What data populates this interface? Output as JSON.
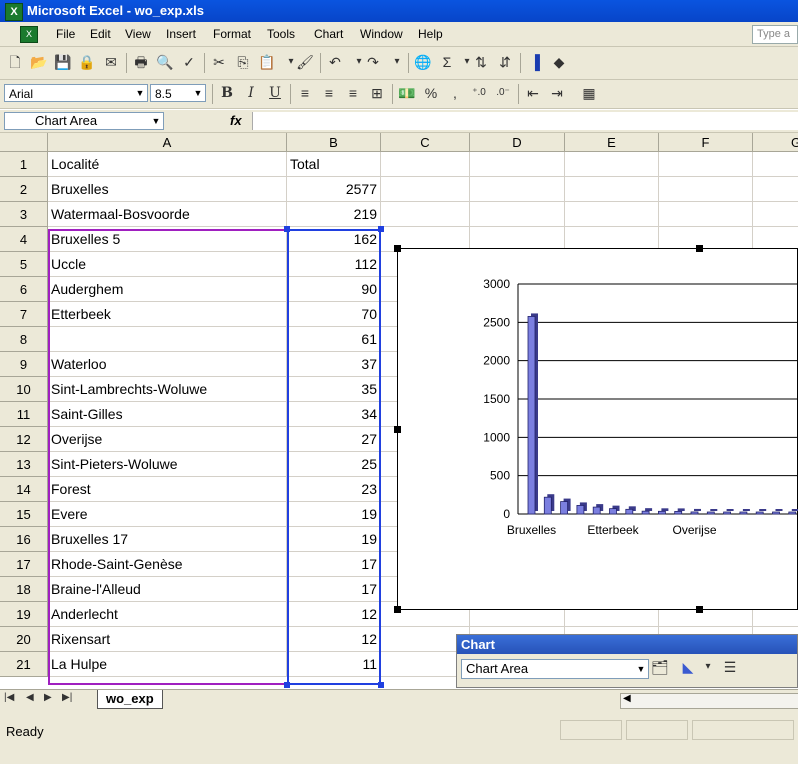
{
  "window": {
    "title": "Microsoft Excel - wo_exp.xls"
  },
  "menu": {
    "items": [
      "File",
      "Edit",
      "View",
      "Insert",
      "Format",
      "Tools",
      "Chart",
      "Window",
      "Help"
    ],
    "type_question": "Type a"
  },
  "format_toolbar": {
    "font": "Arial",
    "size": "8.5",
    "percent": "%",
    "comma": ","
  },
  "formula_bar": {
    "name_box": "Chart Area",
    "fx": "fx"
  },
  "columns": [
    "A",
    "B",
    "C",
    "D",
    "E",
    "F",
    "G"
  ],
  "rows": [
    {
      "n": "1",
      "a": "Localité",
      "b": "Total"
    },
    {
      "n": "2",
      "a": "Bruxelles",
      "b": "2577"
    },
    {
      "n": "3",
      "a": "Watermaal-Bosvoorde",
      "b": "219"
    },
    {
      "n": "4",
      "a": "Bruxelles 5",
      "b": "162"
    },
    {
      "n": "5",
      "a": "Uccle",
      "b": "112"
    },
    {
      "n": "6",
      "a": "Auderghem",
      "b": "90"
    },
    {
      "n": "7",
      "a": "Etterbeek",
      "b": "70"
    },
    {
      "n": "8",
      "a": "",
      "b": "61"
    },
    {
      "n": "9",
      "a": "Waterloo",
      "b": "37"
    },
    {
      "n": "10",
      "a": "Sint-Lambrechts-Woluwe",
      "b": "35"
    },
    {
      "n": "11",
      "a": "Saint-Gilles",
      "b": "34"
    },
    {
      "n": "12",
      "a": "Overijse",
      "b": "27"
    },
    {
      "n": "13",
      "a": "Sint-Pieters-Woluwe",
      "b": "25"
    },
    {
      "n": "14",
      "a": "Forest",
      "b": "23"
    },
    {
      "n": "15",
      "a": "Evere",
      "b": "19"
    },
    {
      "n": "16",
      "a": "Bruxelles 17",
      "b": "19"
    },
    {
      "n": "17",
      "a": "Rhode-Saint-Genèse",
      "b": "17"
    },
    {
      "n": "18",
      "a": "Braine-l'Alleud",
      "b": "17"
    },
    {
      "n": "19",
      "a": "Anderlecht",
      "b": "12"
    },
    {
      "n": "20",
      "a": "Rixensart",
      "b": "12"
    },
    {
      "n": "21",
      "a": "La Hulpe",
      "b": "11"
    }
  ],
  "chart_data": {
    "type": "bar",
    "categories": [
      "Bruxelles",
      "Watermaal-Bosvoorde",
      "Bruxelles 5",
      "Uccle",
      "Auderghem",
      "Etterbeek",
      "",
      "Waterloo",
      "Sint-Lambrechts-Woluwe",
      "Saint-Gilles",
      "Overijse",
      "Sint-Pieters-Woluwe",
      "Forest",
      "Evere",
      "Bruxelles 17",
      "Rhode-Saint-Genèse",
      "Braine-l'Alleud",
      "Anderlecht",
      "Rixensart"
    ],
    "values": [
      2577,
      219,
      162,
      112,
      90,
      70,
      61,
      37,
      35,
      34,
      27,
      25,
      23,
      19,
      19,
      17,
      17,
      12,
      12
    ],
    "visible_tick_labels": [
      "Bruxelles",
      "Etterbeek",
      "Overijse"
    ],
    "y_ticks": [
      "0",
      "500",
      "1000",
      "1500",
      "2000",
      "2500",
      "3000"
    ],
    "ylim": [
      0,
      3000
    ],
    "grid": true,
    "bar_color": "#7b7fe0"
  },
  "chart_toolbar": {
    "title": "Chart",
    "selection": "Chart Area"
  },
  "sheet_tab": "wo_exp",
  "status": "Ready"
}
